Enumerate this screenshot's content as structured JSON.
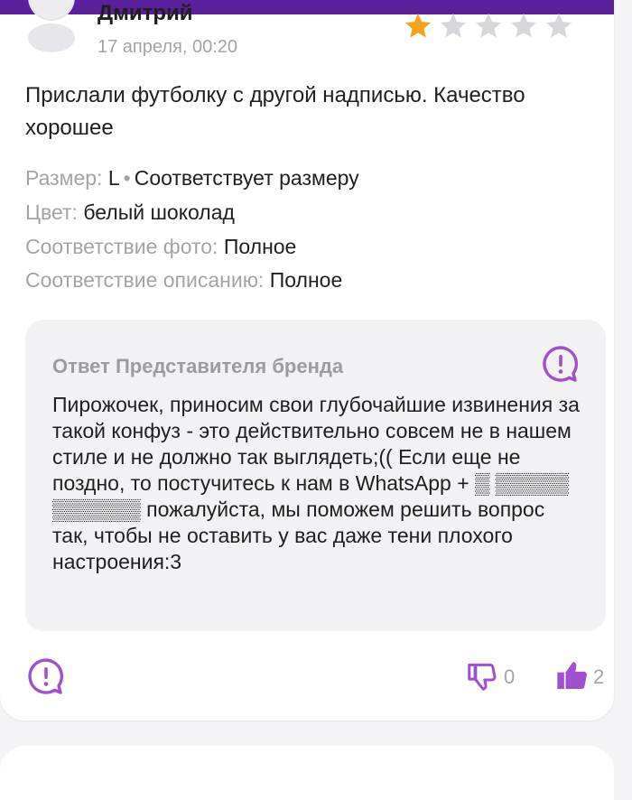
{
  "review": {
    "author": "Дмитрий",
    "date": "17 апреля, 00:20",
    "rating": 1,
    "max_rating": 5,
    "text": "Прислали футболку с другой надписью. Качество хорошее",
    "size_label": "Размер:",
    "size_value": "L",
    "size_fit": "Соответствует размеру",
    "color_label": "Цвет:",
    "color_value": "белый шоколад",
    "photo_match_label": "Соответствие фото:",
    "photo_match_value": "Полное",
    "desc_match_label": "Соответствие описанию:",
    "desc_match_value": "Полное"
  },
  "reply": {
    "title": "Ответ Представителя бренда",
    "text": "Пирожочек, приносим свои глубочайшие извинения за такой конфуз - это действительно совсем не в нашем стиле и не должно так выглядеть;(( Если еще не поздно, то постучитесь к нам в WhatsApp + ▒ ▒▒▒▒▒ ▒▒▒▒▒▒ пожалуйста, мы поможем решить вопрос так, чтобы не оставить у вас даже тени плохого настроения:3"
  },
  "footer": {
    "dislike_count": "0",
    "like_count": "2"
  },
  "colors": {
    "brand_purple": "#5a1f9a",
    "accent_purple": "#a04fd1",
    "star_active": "#f7a21b",
    "star_inactive": "#d6d6db",
    "muted_text": "#a3a3a9"
  },
  "icons": {
    "avatar": "user-avatar-icon",
    "report": "exclamation-bubble-icon",
    "dislike": "thumbs-down-icon",
    "like": "thumbs-up-icon",
    "star": "star-icon"
  }
}
